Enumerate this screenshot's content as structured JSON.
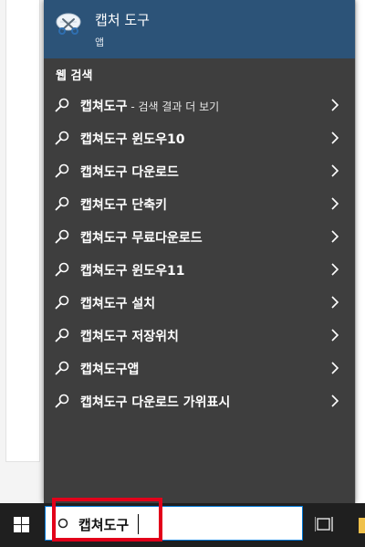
{
  "best_match": {
    "app_name": "캡처 도구",
    "app_type": "앱"
  },
  "web_search": {
    "section_label": "웹 검색",
    "results": [
      {
        "query": "캡쳐도구",
        "suffix": " - 검색 결과 더 보기"
      },
      {
        "query": "캡쳐도구 윈도우10",
        "suffix": ""
      },
      {
        "query": "캡쳐도구 다운로드",
        "suffix": ""
      },
      {
        "query": "캡쳐도구 단축키",
        "suffix": ""
      },
      {
        "query": "캡쳐도구 무료다운로드",
        "suffix": ""
      },
      {
        "query": "캡쳐도구 윈도우11",
        "suffix": ""
      },
      {
        "query": "캡쳐도구 설치",
        "suffix": ""
      },
      {
        "query": "캡쳐도구 저장위치",
        "suffix": ""
      },
      {
        "query": "캡쳐도구앱",
        "suffix": ""
      },
      {
        "query": "캡쳐도구 다운로드 가위표시",
        "suffix": ""
      }
    ]
  },
  "taskbar": {
    "search_value": "캡쳐도구"
  },
  "colors": {
    "panel_bg": "#3e3e3e",
    "best_match_bg": "#2c5378",
    "taskbar_bg": "#1f1f1f",
    "highlight_border": "#e2001a"
  },
  "icons": {
    "app": "scissors-snipping-tool-icon",
    "result": "search-icon",
    "row_action": "chevron-right-icon",
    "start": "windows-logo-icon",
    "search_box": "search-circle-icon",
    "task_view": "task-view-icon"
  }
}
